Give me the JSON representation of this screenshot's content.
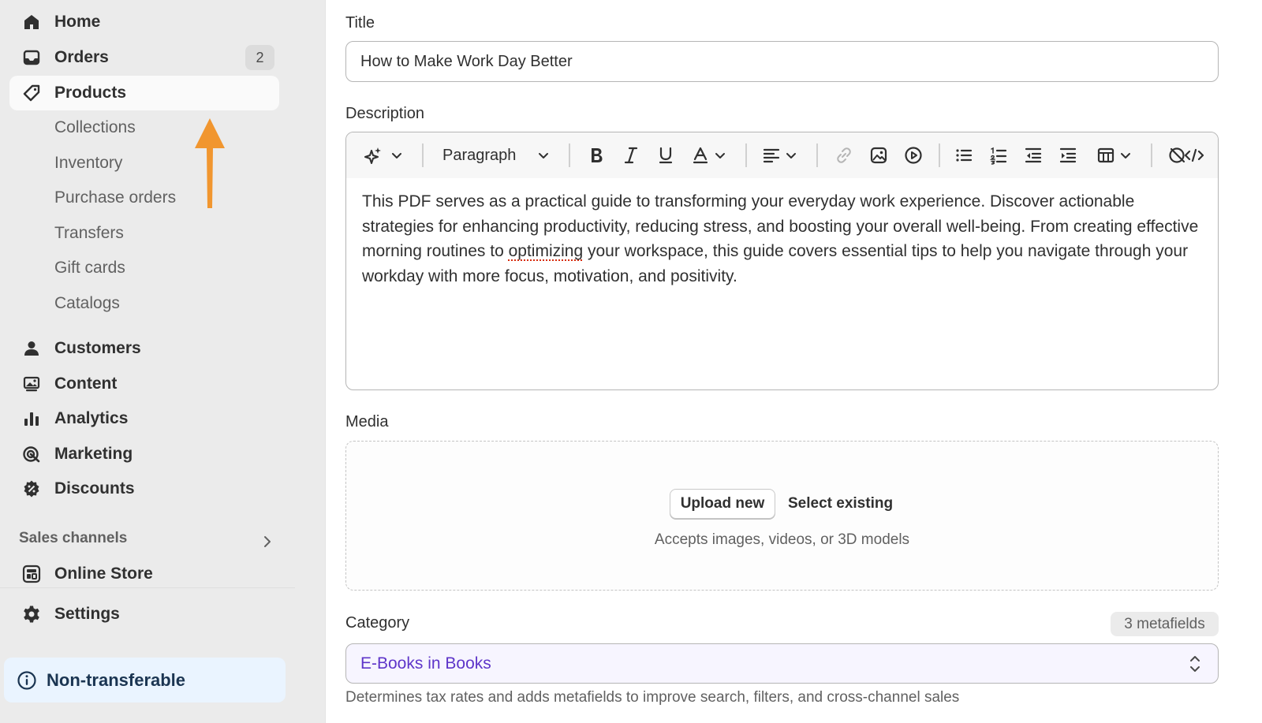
{
  "sidebar": {
    "items": [
      {
        "label": "Home",
        "icon": "home-icon"
      },
      {
        "label": "Orders",
        "icon": "inbox-icon",
        "badge": "2"
      },
      {
        "label": "Products",
        "icon": "tag-icon"
      },
      {
        "label": "Collections"
      },
      {
        "label": "Inventory"
      },
      {
        "label": "Purchase orders"
      },
      {
        "label": "Transfers"
      },
      {
        "label": "Gift cards"
      },
      {
        "label": "Catalogs"
      },
      {
        "label": "Customers",
        "icon": "person-icon"
      },
      {
        "label": "Content",
        "icon": "image-icon"
      },
      {
        "label": "Analytics",
        "icon": "bar-chart-icon"
      },
      {
        "label": "Marketing",
        "icon": "target-icon"
      },
      {
        "label": "Discounts",
        "icon": "discount-icon"
      }
    ],
    "sales_channels_label": "Sales channels",
    "online_store_label": "Online Store",
    "settings_label": "Settings",
    "banner_label": "Non-transferable"
  },
  "form": {
    "title_label": "Title",
    "title_value": "How to Make Work Day Better",
    "description_label": "Description",
    "paragraph_label": "Paragraph",
    "description_before": "This PDF serves as a practical guide to transforming your everyday work experience. Discover actionable strategies for enhancing productivity, reducing stress, and boosting your overall well-being. From creating effective morning routines to ",
    "description_misspelled": "optimizing",
    "description_after": " your workspace, this guide covers essential tips to help you navigate through your workday with more focus, motivation, and positivity.",
    "media_label": "Media",
    "upload_label": "Upload new",
    "select_existing_label": "Select existing",
    "media_hint": "Accepts images, videos, or 3D models",
    "category_label": "Category",
    "metafields_label": "3 metafields",
    "category_value": "E-Books in Books",
    "category_hint": "Determines tax rates and adds metafields to improve search, filters, and cross-channel sales"
  },
  "colors": {
    "accent_arrow": "#f1962f",
    "category_text": "#5e35c9",
    "banner_bg": "#eaf4ff"
  }
}
